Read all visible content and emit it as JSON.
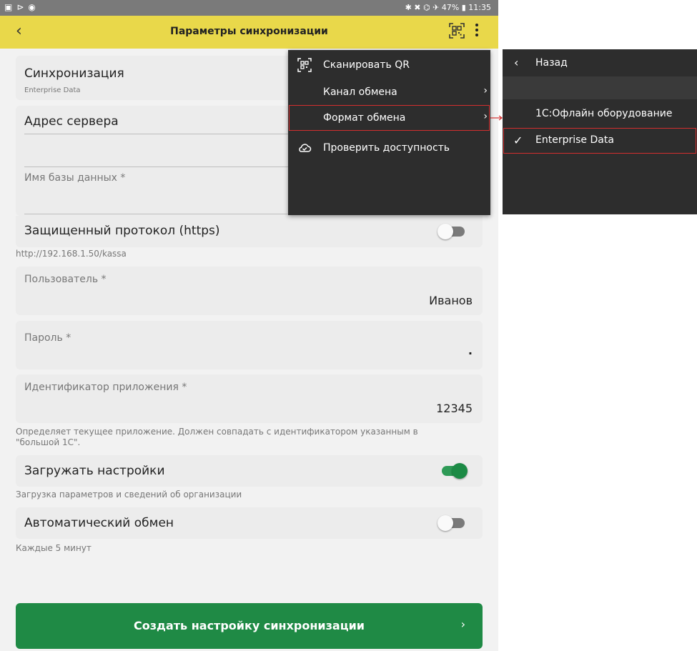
{
  "status_bar": {
    "left_icons": [
      "gallery-icon",
      "play-icon",
      "sync-icon"
    ],
    "right_text": "✱ ✖ ⌬ ✈ 47% ▮ 11:35"
  },
  "toolbar": {
    "title": "Параметры синхронизации",
    "accent_color": "#e9d84a"
  },
  "sync": {
    "label": "Синхронизация",
    "value": "Enterprise Data"
  },
  "server": {
    "label": "Адрес сервера",
    "value": ""
  },
  "database": {
    "label": "Имя базы данных *",
    "value": ""
  },
  "https": {
    "label": "Защищенный протокол (https)",
    "enabled": false,
    "hint": "http://192.168.1.50/kassa"
  },
  "user": {
    "label": "Пользователь *",
    "value": "Иванов"
  },
  "password": {
    "label": "Пароль *",
    "value": "."
  },
  "app_id": {
    "label": "Идентификатор приложения *",
    "value": "12345",
    "hint_line1": "Определяет текущее приложение. Должен совпадать с идентификатором указанным в",
    "hint_line2": "\"большой 1С\"."
  },
  "load_settings": {
    "label": "Загружать настройки",
    "enabled": true,
    "hint": "Загрузка параметров и сведений об организации"
  },
  "auto_exchange": {
    "label": "Автоматический обмен",
    "enabled": false,
    "hint": "Каждые 5 минут"
  },
  "create_button": {
    "label": "Создать настройку синхронизации",
    "color": "#1f8a45"
  },
  "menu": {
    "items": [
      {
        "label": "Сканировать QR",
        "icon": "qr-icon"
      },
      {
        "label": "Канал обмена",
        "has_submenu": true
      },
      {
        "label": "Формат обмена",
        "has_submenu": true,
        "highlighted": true
      },
      {
        "label": "Проверить доступность",
        "icon": "cloud-check-icon"
      }
    ]
  },
  "submenu": {
    "back_label": "Назад",
    "options": [
      {
        "label": "1С:Офлайн оборудование",
        "selected": false
      },
      {
        "label": "Enterprise Data",
        "selected": true
      }
    ]
  },
  "highlight_color": "#d32f2f"
}
